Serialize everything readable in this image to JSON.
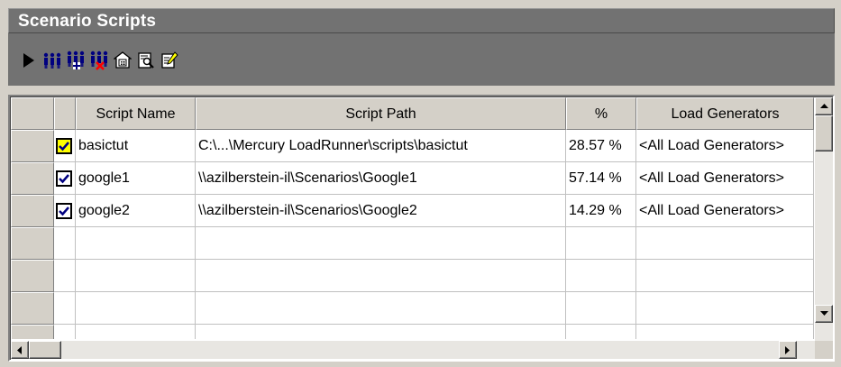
{
  "panel": {
    "title": "Scenario Scripts"
  },
  "toolbar": {
    "buttons": [
      {
        "name": "run-button",
        "icon": "play-icon"
      },
      {
        "name": "vusers-button",
        "icon": "vusers-icon"
      },
      {
        "name": "add-vusers-button",
        "icon": "add-vusers-icon"
      },
      {
        "name": "remove-vusers-button",
        "icon": "remove-vusers-icon"
      },
      {
        "name": "script-details-button",
        "icon": "details-icon"
      },
      {
        "name": "view-script-button",
        "icon": "view-script-icon"
      },
      {
        "name": "edit-script-button",
        "icon": "edit-script-icon"
      }
    ]
  },
  "grid": {
    "columns": [
      "Script Name",
      "Script Path",
      "%",
      "Load Generators"
    ],
    "rows": [
      {
        "checked": true,
        "focused": true,
        "name": "basictut",
        "path": "C:\\...\\Mercury LoadRunner\\scripts\\basictut",
        "percent": "28.57 %",
        "generators": "<All Load Generators>"
      },
      {
        "checked": true,
        "focused": false,
        "name": "google1",
        "path": "\\\\azilberstein-il\\Scenarios\\Google1",
        "percent": "57.14 %",
        "generators": "<All Load Generators>"
      },
      {
        "checked": true,
        "focused": false,
        "name": "google2",
        "path": "\\\\azilberstein-il\\Scenarios\\Google2",
        "percent": "14.29 %",
        "generators": "<All Load Generators>"
      }
    ],
    "empty_rows": 4
  },
  "colors": {
    "panel_bg": "#d4d0c8",
    "title_bar": "#727272",
    "icon_blue": "#000080",
    "icon_red": "#ff0000"
  }
}
